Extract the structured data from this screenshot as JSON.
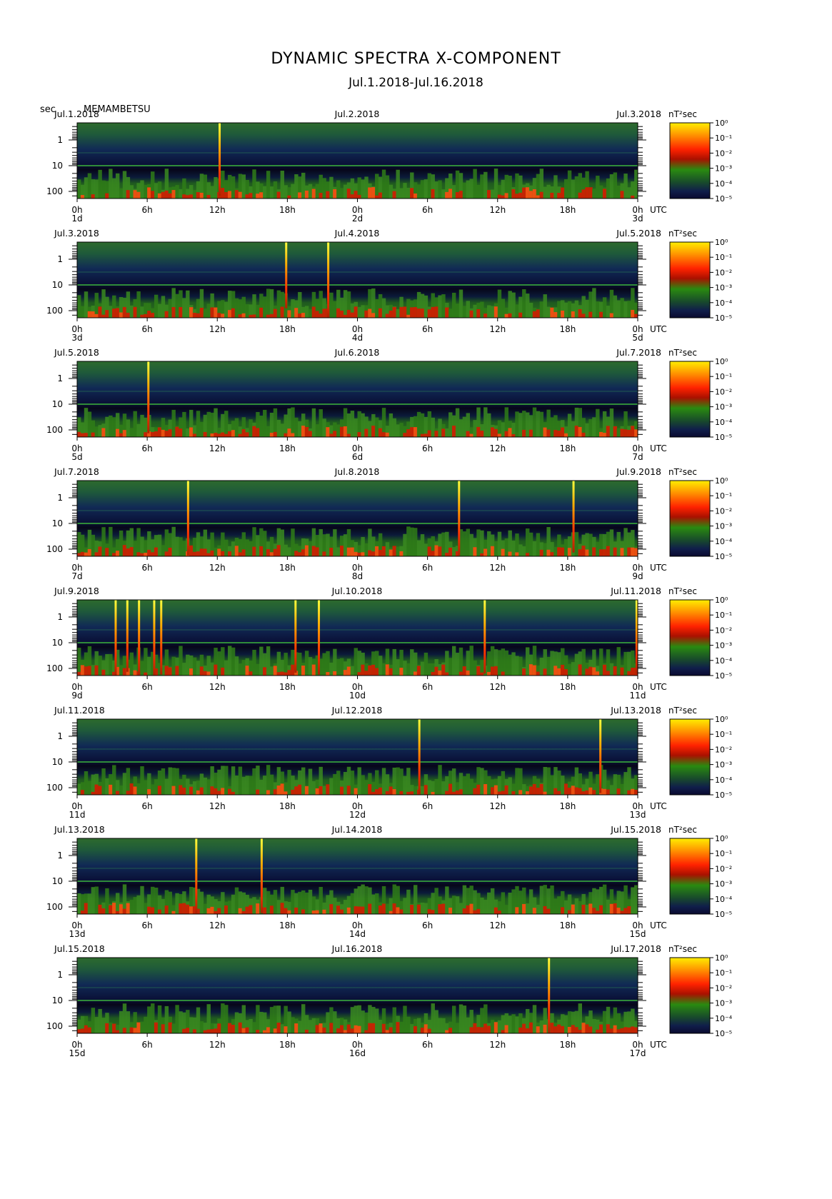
{
  "title": "DYNAMIC SPECTRA X-COMPONENT",
  "subtitle": "Jul.1.2018-Jul.16.2018",
  "y_unit": "sec",
  "station": "MEMAMBETSU",
  "colorbar": {
    "unit": "nT²sec",
    "ticks": [
      "10⁰",
      "10⁻¹",
      "10⁻²",
      "10⁻³",
      "10⁻⁴",
      "10⁻⁵"
    ],
    "colors": [
      "#ffee00",
      "#ff8800",
      "#ff2200",
      "#cc0000",
      "#228800",
      "#1a4d22",
      "#0a1040"
    ]
  },
  "chart_data": {
    "type": "heatmap",
    "y_axis": {
      "scale": "log",
      "ticks": [
        "1",
        "10",
        "100"
      ]
    },
    "x_ticks": [
      "0h",
      "6h",
      "12h",
      "18h",
      "0h",
      "6h",
      "12h",
      "18h",
      "0h"
    ],
    "x_unit": "UTC",
    "panels": [
      {
        "dates": [
          "Jul.1.2018",
          "Jul.2.2018",
          "Jul.3.2018"
        ],
        "days": [
          "1d",
          "2d",
          "3d"
        ],
        "spikes": [
          {
            "hour": 12.2,
            "intensity": 0.85
          }
        ]
      },
      {
        "dates": [
          "Jul.3.2018",
          "Jul.4.2018",
          "Jul.5.2018"
        ],
        "days": [
          "3d",
          "4d",
          "5d"
        ],
        "spikes": [
          {
            "hour": 21.5,
            "intensity": 1.0
          },
          {
            "hour": 17.9,
            "intensity": 0.5
          }
        ]
      },
      {
        "dates": [
          "Jul.5.2018",
          "Jul.6.2018",
          "Jul.7.2018"
        ],
        "days": [
          "5d",
          "6d",
          "7d"
        ],
        "spikes": [
          {
            "hour": 6.1,
            "intensity": 0.8
          }
        ]
      },
      {
        "dates": [
          "Jul.7.2018",
          "Jul.8.2018",
          "Jul.9.2018"
        ],
        "days": [
          "7d",
          "8d",
          "9d"
        ],
        "spikes": [
          {
            "hour": 9.5,
            "intensity": 0.95
          },
          {
            "hour": 32.7,
            "intensity": 0.95
          },
          {
            "hour": 42.5,
            "intensity": 0.8
          }
        ]
      },
      {
        "dates": [
          "Jul.9.2018",
          "Jul.10.2018",
          "Jul.11.2018"
        ],
        "days": [
          "9d",
          "10d",
          "11d"
        ],
        "spikes": [
          {
            "hour": 3.3,
            "intensity": 1.0
          },
          {
            "hour": 4.3,
            "intensity": 0.8
          },
          {
            "hour": 5.3,
            "intensity": 1.0
          },
          {
            "hour": 6.6,
            "intensity": 1.0
          },
          {
            "hour": 7.2,
            "intensity": 0.95
          },
          {
            "hour": 18.7,
            "intensity": 0.85
          },
          {
            "hour": 20.7,
            "intensity": 0.95
          },
          {
            "hour": 34.9,
            "intensity": 0.9
          },
          {
            "hour": 47.9,
            "intensity": 0.9
          }
        ]
      },
      {
        "dates": [
          "Jul.11.2018",
          "Jul.12.2018",
          "Jul.13.2018"
        ],
        "days": [
          "11d",
          "12d",
          "13d"
        ],
        "spikes": [
          {
            "hour": 29.3,
            "intensity": 0.95
          },
          {
            "hour": 44.8,
            "intensity": 0.9
          }
        ]
      },
      {
        "dates": [
          "Jul.13.2018",
          "Jul.14.2018",
          "Jul.15.2018"
        ],
        "days": [
          "13d",
          "14d",
          "15d"
        ],
        "spikes": [
          {
            "hour": 10.2,
            "intensity": 0.95
          },
          {
            "hour": 15.8,
            "intensity": 0.95
          }
        ]
      },
      {
        "dates": [
          "Jul.15.2018",
          "Jul.16.2018",
          "Jul.17.2018"
        ],
        "days": [
          "15d",
          "16d",
          "17d"
        ],
        "spikes": [
          {
            "hour": 40.4,
            "intensity": 1.0
          }
        ]
      }
    ]
  }
}
